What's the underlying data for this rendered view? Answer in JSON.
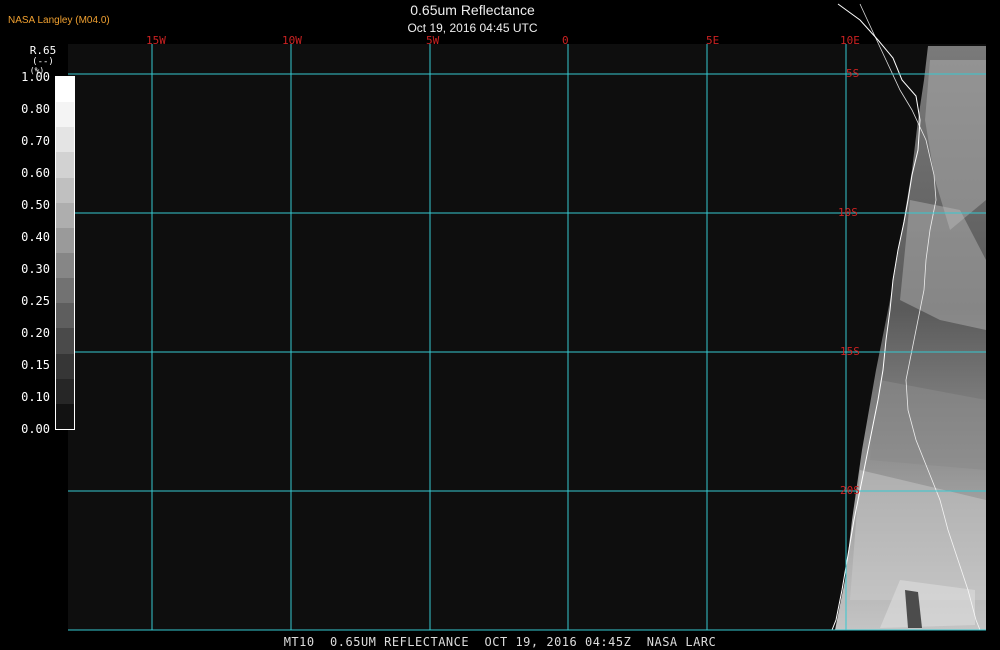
{
  "header": {
    "organization": "NASA Langley (M04.0)",
    "title": "0.65um Reflectance",
    "subtitle": "Oct 19, 2016 04:45 UTC"
  },
  "colorbar": {
    "variable": "R.65",
    "unit": "(--)",
    "unit_extra": "(%)",
    "tick_labels": [
      "1.00",
      "0.80",
      "0.70",
      "0.60",
      "0.50",
      "0.40",
      "0.30",
      "0.25",
      "0.20",
      "0.15",
      "0.10",
      "0.00"
    ],
    "colors": [
      "#ffffff",
      "#f4f4f4",
      "#e4e4e4",
      "#d2d2d2",
      "#c0c0c0",
      "#aeaeae",
      "#9a9a9a",
      "#868686",
      "#727272",
      "#5e5e5e",
      "#4a4a4a",
      "#363636",
      "#262626",
      "#121212"
    ]
  },
  "map": {
    "longitude_labels": [
      "15W",
      "10W",
      "5W",
      "0",
      "5E",
      "10E"
    ],
    "latitude_labels": [
      "5S",
      "10S",
      "15S",
      "20S"
    ],
    "grid_color": "#35c8d0",
    "label_color": "#cc2222",
    "background_color": "#0e0e0e"
  },
  "footer": {
    "text": "MT10  0.65UM REFLECTANCE  OCT 19, 2016 04:45Z  NASA LARC"
  }
}
